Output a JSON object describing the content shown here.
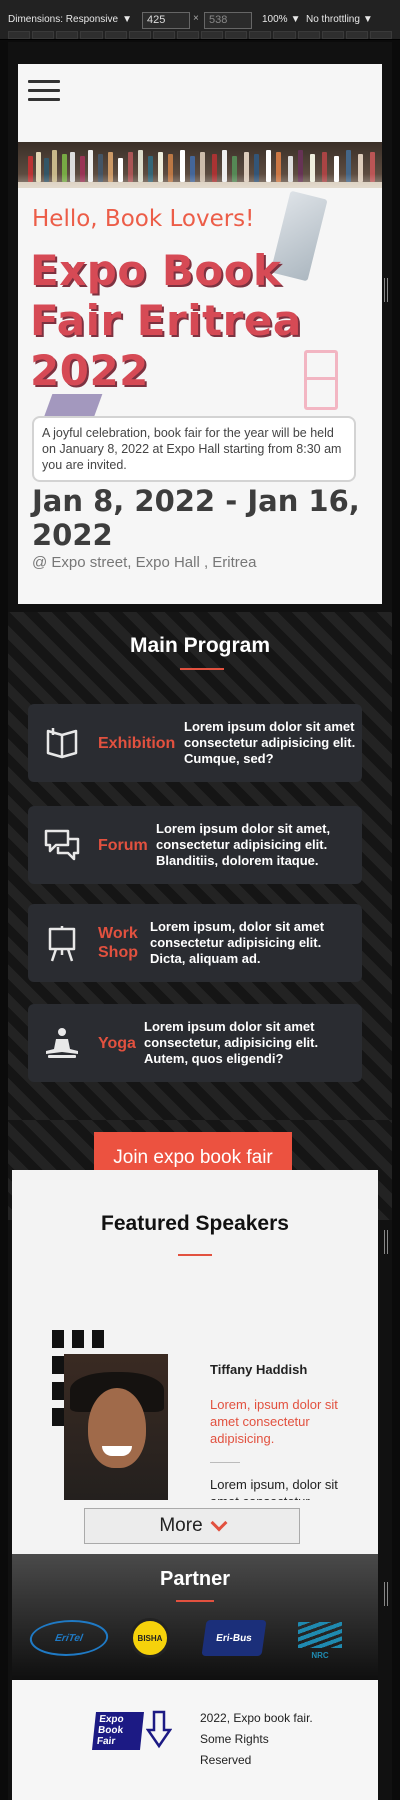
{
  "devtools": {
    "dimensions_label": "Dimensions: Responsive",
    "width": "425",
    "height": "538",
    "zoom": "100%",
    "throttling": "No throttling"
  },
  "hero": {
    "hello": "Hello, Book Lovers!",
    "title": "Expo Book Fair Eritrea 2022",
    "description": "A joyful celebration, book fair for the year will be held on January 8, 2022 at Expo Hall starting from 8:30 am you are invited.",
    "dates": "Jan 8, 2022 - Jan 16, 2022",
    "location": "@ Expo street, Expo Hall , Eritrea"
  },
  "program": {
    "title": "Main Program",
    "items": [
      {
        "name": "Exhibition",
        "text": "Lorem ipsum dolor sit amet consectetur adipisicing elit. Cumque, sed?",
        "icon": "open-book-icon"
      },
      {
        "name": "Forum",
        "text": "Lorem ipsum dolor sit amet, consectetur adipisicing elit. Blanditiis, dolorem itaque.",
        "icon": "chat-bubbles-icon"
      },
      {
        "name": "Work Shop",
        "text": "Lorem ipsum, dolor sit amet consectetur adipisicing elit. Dicta, aliquam ad.",
        "icon": "easel-board-icon"
      },
      {
        "name": "Yoga",
        "text": "Lorem ipsum dolor sit amet consectetur, adipisicing elit. Autem, quos eligendi?",
        "icon": "meditation-icon"
      }
    ],
    "cta": "Join expo book fair"
  },
  "speakers": {
    "title": "Featured Speakers",
    "name": "Tiffany Haddish",
    "role": "Lorem, ipsum dolor sit amet consectetur adipisicing.",
    "bio": "Lorem ipsum, dolor sit amet consectetur",
    "more": "More"
  },
  "partner": {
    "title": "Partner",
    "logos": [
      "EriTel",
      "BISHA",
      "Eri-Bus",
      "NRC"
    ]
  },
  "footer": {
    "logo_text": "Expo Book Fair",
    "line1": "2022, Expo book fair.",
    "line2": "Some Rights",
    "line3": "Reserved"
  },
  "colors": {
    "accent": "#e2513f",
    "title": "#d64a55",
    "card_bg": "#2a2c31"
  }
}
